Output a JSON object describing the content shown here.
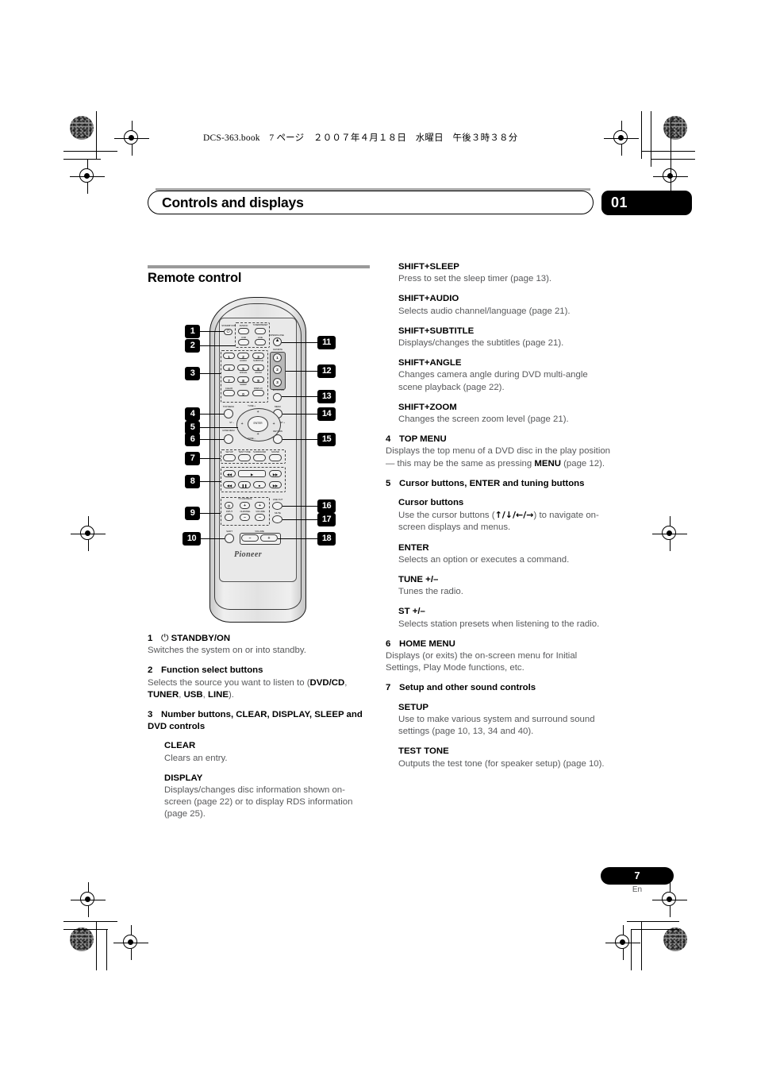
{
  "header": {
    "file_stamp": "DCS-363.book　7 ページ　２００７年４月１８日　水曜日　午後３時３８分",
    "chapter_title": "Controls and displays",
    "chapter_number": "01"
  },
  "section": {
    "title": "Remote control"
  },
  "footer": {
    "page_number": "7",
    "language": "En"
  },
  "left_column": {
    "item1": {
      "number": "1",
      "power_symbol": "⏻",
      "title": "STANDBY/ON",
      "body": "Switches the system on or into standby."
    },
    "item2": {
      "number": "2",
      "title": "Function select buttons",
      "body_prefix": "Selects the source you want to listen to (",
      "source1": "DVD/CD",
      "sep1": ", ",
      "source2": "TUNER",
      "sep2": ", ",
      "source3": "USB",
      "sep3": ", ",
      "source4": "LINE",
      "body_suffix": ")."
    },
    "item3": {
      "number": "3",
      "title": "Number buttons, CLEAR, DISPLAY, SLEEP and DVD controls",
      "sub1_title": "CLEAR",
      "sub1_body": "Clears an entry.",
      "sub2_title": "DISPLAY",
      "sub2_body": "Displays/changes disc information shown on-screen (page 22) or to display RDS information (page 25)."
    }
  },
  "right_column": {
    "shift_sleep": {
      "title": "SHIFT+SLEEP",
      "body": "Press to set the sleep timer (page 13)."
    },
    "shift_audio": {
      "title": "SHIFT+AUDIO",
      "body": "Selects audio channel/language (page 21)."
    },
    "shift_subtitle": {
      "title": "SHIFT+SUBTITLE",
      "body": "Displays/changes the subtitles (page 21)."
    },
    "shift_angle": {
      "title": "SHIFT+ANGLE",
      "body": "Changes camera angle during DVD multi-angle scene playback (page 22)."
    },
    "shift_zoom": {
      "title": "SHIFT+ZOOM",
      "body": "Changes the screen zoom level (page 21)."
    },
    "item4": {
      "number": "4",
      "title": "TOP MENU",
      "body_prefix": "Displays the top menu of a DVD disc in the play position — this may be the same as pressing ",
      "body_bold": "MENU",
      "body_suffix": " (page 12)."
    },
    "item5": {
      "number": "5",
      "title": "Cursor buttons, ENTER and tuning buttons",
      "sub1_title": "Cursor buttons",
      "sub1_body_prefix": "Use the cursor buttons (",
      "sub1_arrows": "↑/↓/←/→",
      "sub1_body_suffix": ") to navigate on-screen displays and menus.",
      "sub2_title": "ENTER",
      "sub2_body": "Selects an option or executes a command.",
      "sub3_title": "TUNE +/–",
      "sub3_body": "Tunes the radio.",
      "sub4_title": "ST +/–",
      "sub4_body": "Selects station presets when listening to the radio."
    },
    "item6": {
      "number": "6",
      "title": "HOME MENU",
      "body": "Displays (or exits) the on-screen menu for Initial Settings, Play Mode functions, etc."
    },
    "item7": {
      "number": "7",
      "title": "Setup and other sound controls",
      "sub1_title": "SETUP",
      "sub1_body": "Use to make various system and surround sound settings (page 10, 13, 34 and 40).",
      "sub2_title": "TEST TONE",
      "sub2_body": "Outputs the test tone (for speaker setup) (page 10)."
    }
  },
  "remote_diagram": {
    "brand": "Pioneer",
    "callouts_left": [
      "1",
      "2",
      "3",
      "4",
      "5",
      "6",
      "7",
      "8",
      "9",
      "10"
    ],
    "callouts_right": [
      "11",
      "12",
      "13",
      "14",
      "15",
      "16",
      "17",
      "18"
    ],
    "buttons": {
      "standby": "STANDBY/ON",
      "dvd_cd": "DVD/CD",
      "tuner": "TUNER/PRESET",
      "usb": "USB",
      "line": "LINE",
      "open_close": "OPEN/CLOSE",
      "favorite": "FAVORITE",
      "fav1": "1",
      "fav2": "2",
      "fav3": "3",
      "extra_pwr": "EXTRA PWR",
      "n1": "1",
      "n2": "2",
      "n2_sub": "AUDIO",
      "n3": "3",
      "n3_sub": "SUBTITLE",
      "n4": "4",
      "n5": "5",
      "n5_sub": "ANGLE",
      "n6": "6",
      "n6_sub": "ZOOM",
      "n7": "7",
      "n8": "8",
      "n8_sub": "SLEEP",
      "n9": "9",
      "clear": "CLEAR",
      "n0": "0",
      "display": "DISPLAY",
      "top_menu": "TOP MENU",
      "menu": "MENU",
      "tune_plus": "TUNE +",
      "tune_minus": "TUNE –",
      "st_plus": "ST +",
      "st_minus": "ST –",
      "enter": "ENTER",
      "home_menu": "HOME MENU",
      "return": "RETURN",
      "setup": "SETUP",
      "test_tone": "TEST TONE",
      "surround": "SURROUND",
      "sound": "SOUND",
      "prev": "◀◀",
      "play": "▶",
      "next": "▶▶",
      "rew": "◀◀",
      "pause": "❚❚",
      "stop": "■",
      "ff": "▶▶",
      "tv_control": "TV CONTROL",
      "tv_power": "⏻",
      "input": "INPUT",
      "channel": "CHANNEL",
      "volume_tv": "VOLUME",
      "line_out": "LINE OUT",
      "mute": "MUTE",
      "shift": "SHIFT",
      "volume": "VOLUME",
      "vol_minus": "–",
      "vol_plus": "+"
    }
  }
}
